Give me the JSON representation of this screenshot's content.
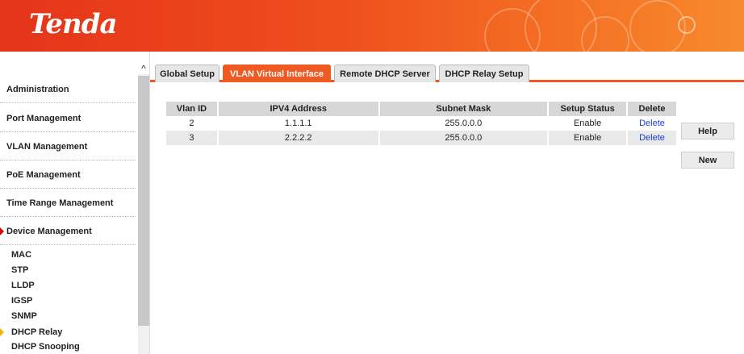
{
  "header": {
    "logo": "Tenda"
  },
  "sidebar": {
    "menu": [
      {
        "label": "Administration"
      },
      {
        "label": "Port Management"
      },
      {
        "label": "VLAN Management"
      },
      {
        "label": "PoE Management"
      },
      {
        "label": "Time Range Management"
      },
      {
        "label": "Device Management"
      }
    ],
    "submenu": [
      {
        "label": "MAC"
      },
      {
        "label": "STP"
      },
      {
        "label": "LLDP"
      },
      {
        "label": "IGSP"
      },
      {
        "label": "SNMP"
      },
      {
        "label": "DHCP Relay"
      },
      {
        "label": "DHCP Snooping"
      }
    ]
  },
  "tabs": [
    {
      "label": "Global Setup"
    },
    {
      "label": "VLAN Virtual Interface"
    },
    {
      "label": "Remote DHCP Server"
    },
    {
      "label": "DHCP Relay Setup"
    }
  ],
  "table": {
    "headers": [
      "Vlan ID",
      "IPV4 Address",
      "Subnet Mask",
      "Setup Status",
      "Delete"
    ],
    "rows": [
      {
        "vlan": "2",
        "ip": "1.1.1.1",
        "mask": "255.0.0.0",
        "status": "Enable",
        "delete": "Delete"
      },
      {
        "vlan": "3",
        "ip": "2.2.2.2",
        "mask": "255.0.0.0",
        "status": "Enable",
        "delete": "Delete"
      }
    ]
  },
  "buttons": {
    "help": "Help",
    "new": "New"
  },
  "colors": {
    "brand": "#ee5a22",
    "link": "#1a3fd1",
    "active_arrow": "#d01010",
    "sub_arrow": "#f2b500"
  }
}
